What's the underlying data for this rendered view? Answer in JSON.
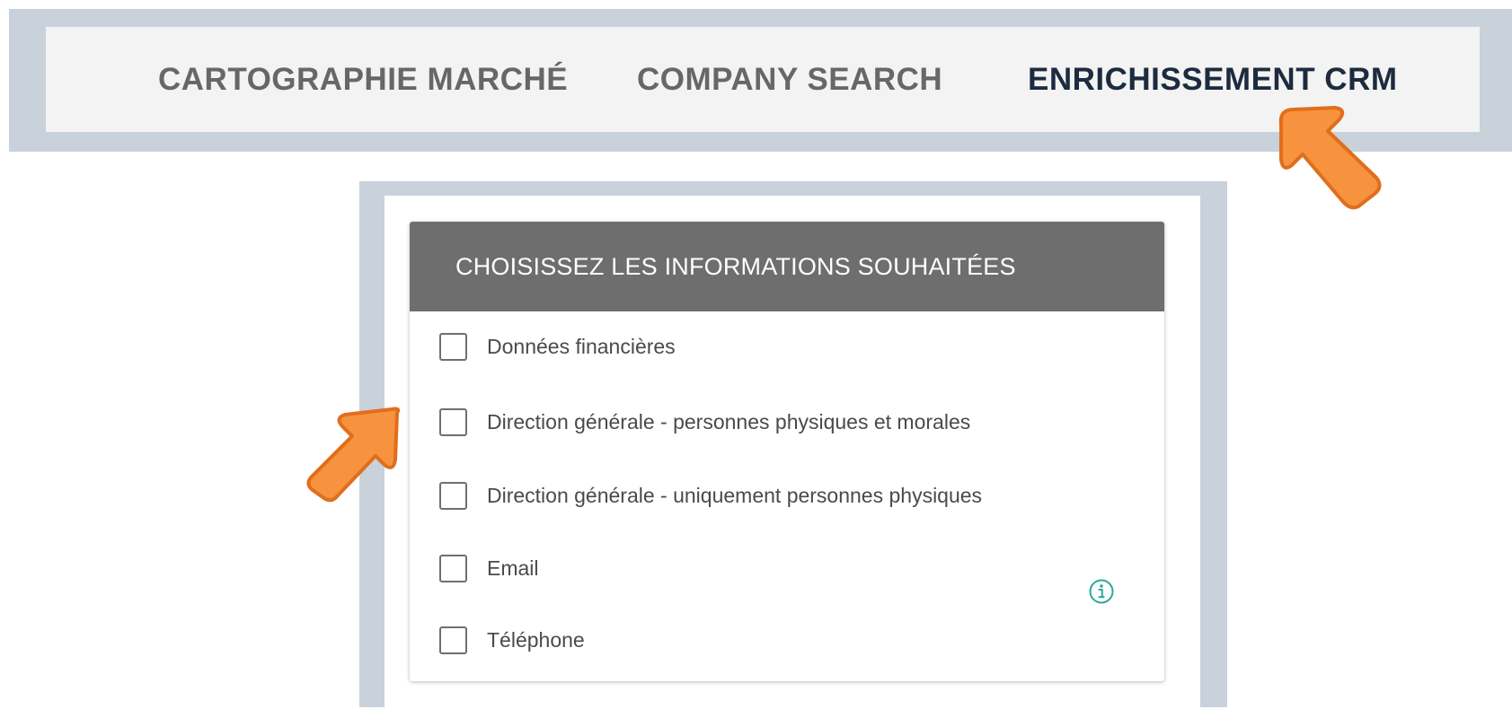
{
  "nav": {
    "tabs": [
      {
        "label": "CARTOGRAPHIE MARCHÉ",
        "active": false
      },
      {
        "label": "COMPANY SEARCH",
        "active": false
      },
      {
        "label": "ENRICHISSEMENT CRM",
        "active": true
      }
    ]
  },
  "panel": {
    "title": "CHOISISSEZ LES INFORMATIONS SOUHAITÉES",
    "options": [
      {
        "label": "Données financières",
        "checked": false
      },
      {
        "label": "Direction générale - personnes physiques et morales",
        "checked": false
      },
      {
        "label": "Direction générale - uniquement personnes physiques",
        "checked": false
      },
      {
        "label": "Email",
        "checked": false
      },
      {
        "label": "Téléphone",
        "checked": false
      }
    ],
    "info_icon": "info-circle-icon"
  },
  "colors": {
    "frame": "#c9d1da",
    "nav_bg": "#f3f3f3",
    "active_tab": "#1d2b3f",
    "inactive_tab": "#676767",
    "header_bg": "#6e6e6e",
    "info_teal": "#2aa89a",
    "arrow_orange": "#f7923e"
  }
}
